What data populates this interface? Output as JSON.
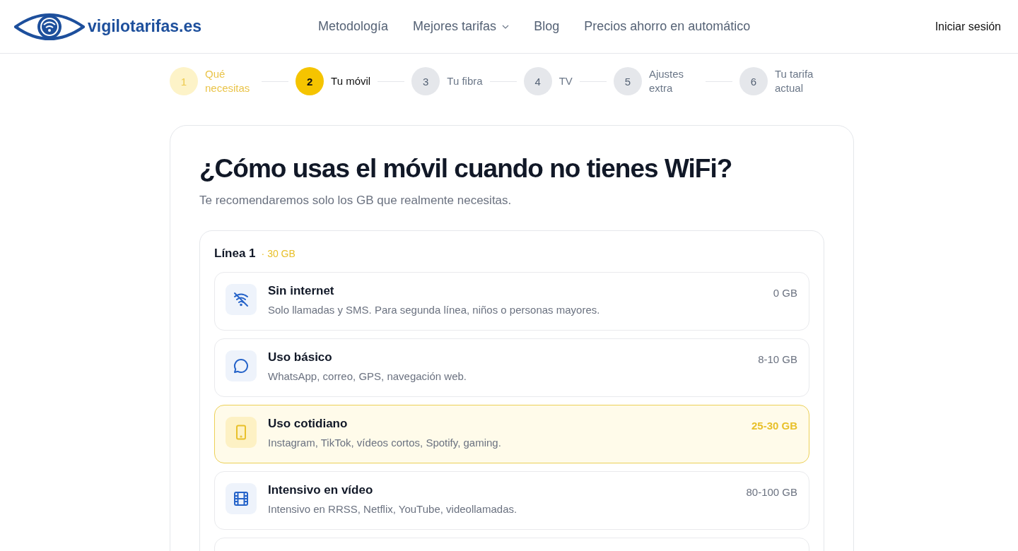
{
  "header": {
    "logo_text": "vigilotarifas.es",
    "nav": [
      {
        "label": "Metodología",
        "dropdown": false
      },
      {
        "label": "Mejores tarifas",
        "dropdown": true
      },
      {
        "label": "Blog",
        "dropdown": false
      },
      {
        "label": "Precios ahorro en automático",
        "dropdown": false
      }
    ],
    "login": "Iniciar sesión"
  },
  "steps": [
    {
      "number": "1",
      "label": "Qué necesitas",
      "completed": true,
      "selected": false
    },
    {
      "number": "2",
      "label": "Tu móvil",
      "completed": false,
      "selected": true
    },
    {
      "number": "3",
      "label": "Tu fibra",
      "completed": false,
      "selected": false
    },
    {
      "number": "4",
      "label": "TV",
      "completed": false,
      "selected": false
    },
    {
      "number": "5",
      "label": "Ajustes extra",
      "completed": false,
      "selected": false
    },
    {
      "number": "6",
      "label": "Tu tarifa actual",
      "completed": false,
      "selected": false
    }
  ],
  "question": {
    "title": "¿Cómo usas el móvil cuando no tienes WiFi?",
    "subtitle": "Te recomendaremos solo los GB que realmente necesitas."
  },
  "line": {
    "title": "Línea 1",
    "summary": "· 30 GB",
    "options": [
      {
        "kind": "none",
        "title": "Sin internet",
        "description": "Solo llamadas y SMS. Para segunda línea, niños o personas mayores.",
        "amount": "0 GB",
        "selected": false
      },
      {
        "kind": "basic",
        "title": "Uso básico",
        "description": "WhatsApp, correo, GPS, navegación web.",
        "amount": "8-10 GB",
        "selected": false
      },
      {
        "kind": "daily",
        "title": "Uso cotidiano",
        "description": "Instagram, TikTok, vídeos cortos, Spotify, gaming.",
        "amount": "25-30 GB",
        "selected": true
      },
      {
        "kind": "video",
        "title": "Intensivo en vídeo",
        "description": "Intensivo en RRSS, Netflix, YouTube, videollamadas.",
        "amount": "80-100 GB",
        "selected": false
      }
    ]
  }
}
